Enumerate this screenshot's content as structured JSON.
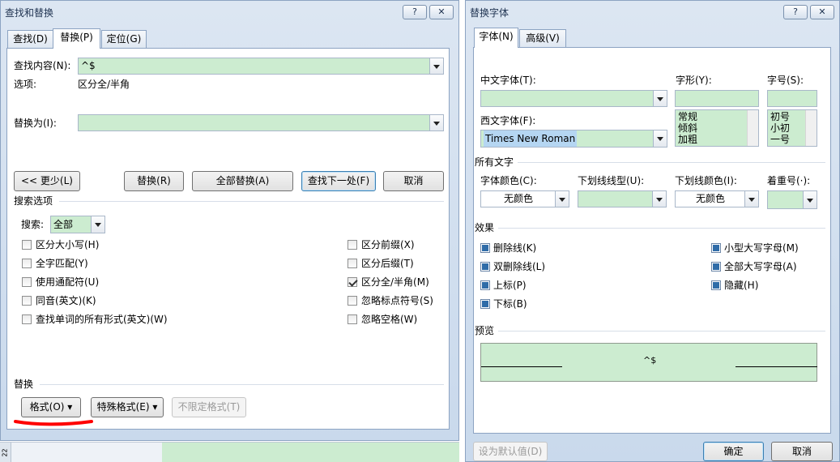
{
  "find_replace": {
    "title": "查找和替换",
    "help_btn": "?",
    "close_btn": "✕",
    "tabs": [
      "查找(D)",
      "替换(P)",
      "定位(G)"
    ],
    "find_label": "查找内容(N):",
    "find_value": "^$",
    "options_label": "选项:",
    "options_value": "区分全/半角",
    "replace_label": "替换为(I):",
    "replace_value": "",
    "less_btn": "<< 更少(L)",
    "replace_btn": "替换(R)",
    "replace_all_btn": "全部替换(A)",
    "find_next_btn": "查找下一处(F)",
    "cancel_btn": "取消",
    "search_options_header": "搜索选项",
    "search_label": "搜索:",
    "search_value": "全部",
    "left_checks": [
      {
        "label": "区分大小写(H)",
        "checked": false
      },
      {
        "label": "全字匹配(Y)",
        "checked": false
      },
      {
        "label": "使用通配符(U)",
        "checked": false
      },
      {
        "label": "同音(英文)(K)",
        "checked": false
      },
      {
        "label": "查找单词的所有形式(英文)(W)",
        "checked": false
      }
    ],
    "right_checks": [
      {
        "label": "区分前缀(X)",
        "checked": false
      },
      {
        "label": "区分后缀(T)",
        "checked": false
      },
      {
        "label": "区分全/半角(M)",
        "checked": true
      },
      {
        "label": "忽略标点符号(S)",
        "checked": false
      },
      {
        "label": "忽略空格(W)",
        "checked": false
      }
    ],
    "replace_section": "替换",
    "format_btn": "格式(O)",
    "special_btn": "特殊格式(E)",
    "no_format_btn": "不限定格式(T)"
  },
  "font_dialog": {
    "title": "替换字体",
    "help_btn": "?",
    "close_btn": "✕",
    "tabs": [
      "字体(N)",
      "高级(V)"
    ],
    "cn_font_label": "中文字体(T):",
    "cn_font_value": "",
    "west_font_label": "西文字体(F):",
    "west_font_value": "Times New Roman",
    "style_label": "字形(Y):",
    "style_value": "",
    "style_list": [
      "常规",
      "倾斜",
      "加粗"
    ],
    "size_label": "字号(S):",
    "size_value": "",
    "size_list": [
      "初号",
      "小初",
      "一号"
    ],
    "all_text_header": "所有文字",
    "font_color_label": "字体颜色(C):",
    "font_color_value": "无颜色",
    "underline_style_label": "下划线线型(U):",
    "underline_style_value": "",
    "underline_color_label": "下划线颜色(I):",
    "underline_color_value": "无颜色",
    "emphasis_label": "着重号(·):",
    "emphasis_value": "",
    "effects_header": "效果",
    "effects_left": [
      "删除线(K)",
      "双删除线(L)",
      "上标(P)",
      "下标(B)"
    ],
    "effects_right": [
      "小型大写字母(M)",
      "全部大写字母(A)",
      "隐藏(H)"
    ],
    "preview_header": "预览",
    "preview_text": "^$",
    "set_default_btn": "设为默认值(D)",
    "ok_btn": "确定",
    "cancel_btn": "取消"
  },
  "doc_strip": {
    "ruler_number": "22"
  },
  "colors": {
    "highlight_green": "#ccecd0",
    "annotation_red": "#ff0000",
    "title_text": "#1e3250"
  }
}
